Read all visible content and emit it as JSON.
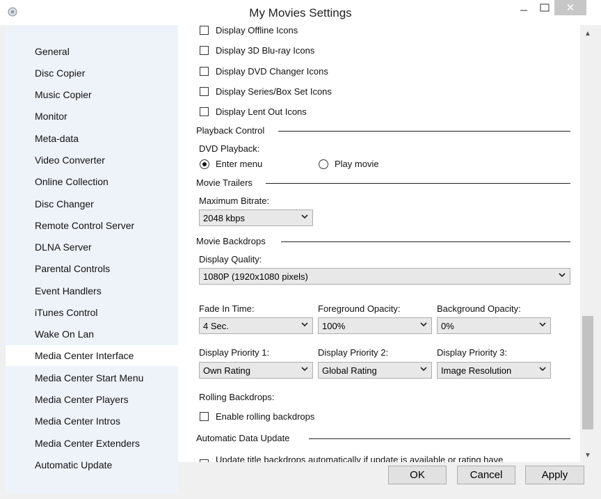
{
  "window": {
    "title": "My Movies Settings",
    "close_glyph": "✕"
  },
  "sidebar": {
    "items": [
      {
        "label": "General"
      },
      {
        "label": "Disc Copier"
      },
      {
        "label": "Music Copier"
      },
      {
        "label": "Monitor"
      },
      {
        "label": "Meta-data"
      },
      {
        "label": "Video Converter"
      },
      {
        "label": "Online Collection"
      },
      {
        "label": "Disc Changer"
      },
      {
        "label": "Remote Control Server"
      },
      {
        "label": "DLNA Server"
      },
      {
        "label": "Parental Controls"
      },
      {
        "label": "Event Handlers"
      },
      {
        "label": "iTunes Control"
      },
      {
        "label": "Wake On Lan"
      },
      {
        "label": "Media Center Interface"
      },
      {
        "label": "Media Center Start Menu"
      },
      {
        "label": "Media Center Players"
      },
      {
        "label": "Media Center Intros"
      },
      {
        "label": "Media Center Extenders"
      },
      {
        "label": "Automatic Update"
      }
    ],
    "selected": "Media Center Interface"
  },
  "content": {
    "icon_options": [
      {
        "label": "Display Offline Icons",
        "checked": false
      },
      {
        "label": "Display 3D Blu-ray Icons",
        "checked": false
      },
      {
        "label": "Display DVD Changer Icons",
        "checked": false
      },
      {
        "label": "Display Series/Box Set Icons",
        "checked": false
      },
      {
        "label": "Display Lent Out Icons",
        "checked": false
      }
    ],
    "playback": {
      "section_title": "Playback Control",
      "dvd_label": "DVD Playback:",
      "options": [
        {
          "label": "Enter menu",
          "selected": true
        },
        {
          "label": "Play movie",
          "selected": false
        }
      ]
    },
    "trailers": {
      "section_title": "Movie Trailers",
      "bitrate_label": "Maximum Bitrate:",
      "bitrate_value": "2048 kbps"
    },
    "backdrops": {
      "section_title": "Movie Backdrops",
      "quality_label": "Display Quality:",
      "quality_value": "1080P (1920x1080 pixels)",
      "fade_label": "Fade In Time:",
      "fade_value": "4 Sec.",
      "fg_opacity_label": "Foreground Opacity:",
      "fg_opacity_value": "100%",
      "bg_opacity_label": "Background Opacity:",
      "bg_opacity_value": "0%",
      "priority1_label": "Display Priority 1:",
      "priority1_value": "Own Rating",
      "priority2_label": "Display Priority 2:",
      "priority2_value": "Global Rating",
      "priority3_label": "Display Priority 3:",
      "priority3_value": "Image Resolution",
      "rolling_label": "Rolling Backdrops:",
      "rolling_checkbox": {
        "label": "Enable rolling backdrops",
        "checked": false
      }
    },
    "auto_update": {
      "section_title": "Automatic Data Update",
      "update_checkbox": {
        "label": "Update title backdrops automatically if update is available or rating have",
        "checked": false
      }
    }
  },
  "buttons": {
    "ok": "OK",
    "cancel": "Cancel",
    "apply": "Apply"
  },
  "colors": {
    "sidebar_bg": "#eef3fa",
    "selected_bg": "#ffffff",
    "close_bg": "#c7c7c7"
  }
}
